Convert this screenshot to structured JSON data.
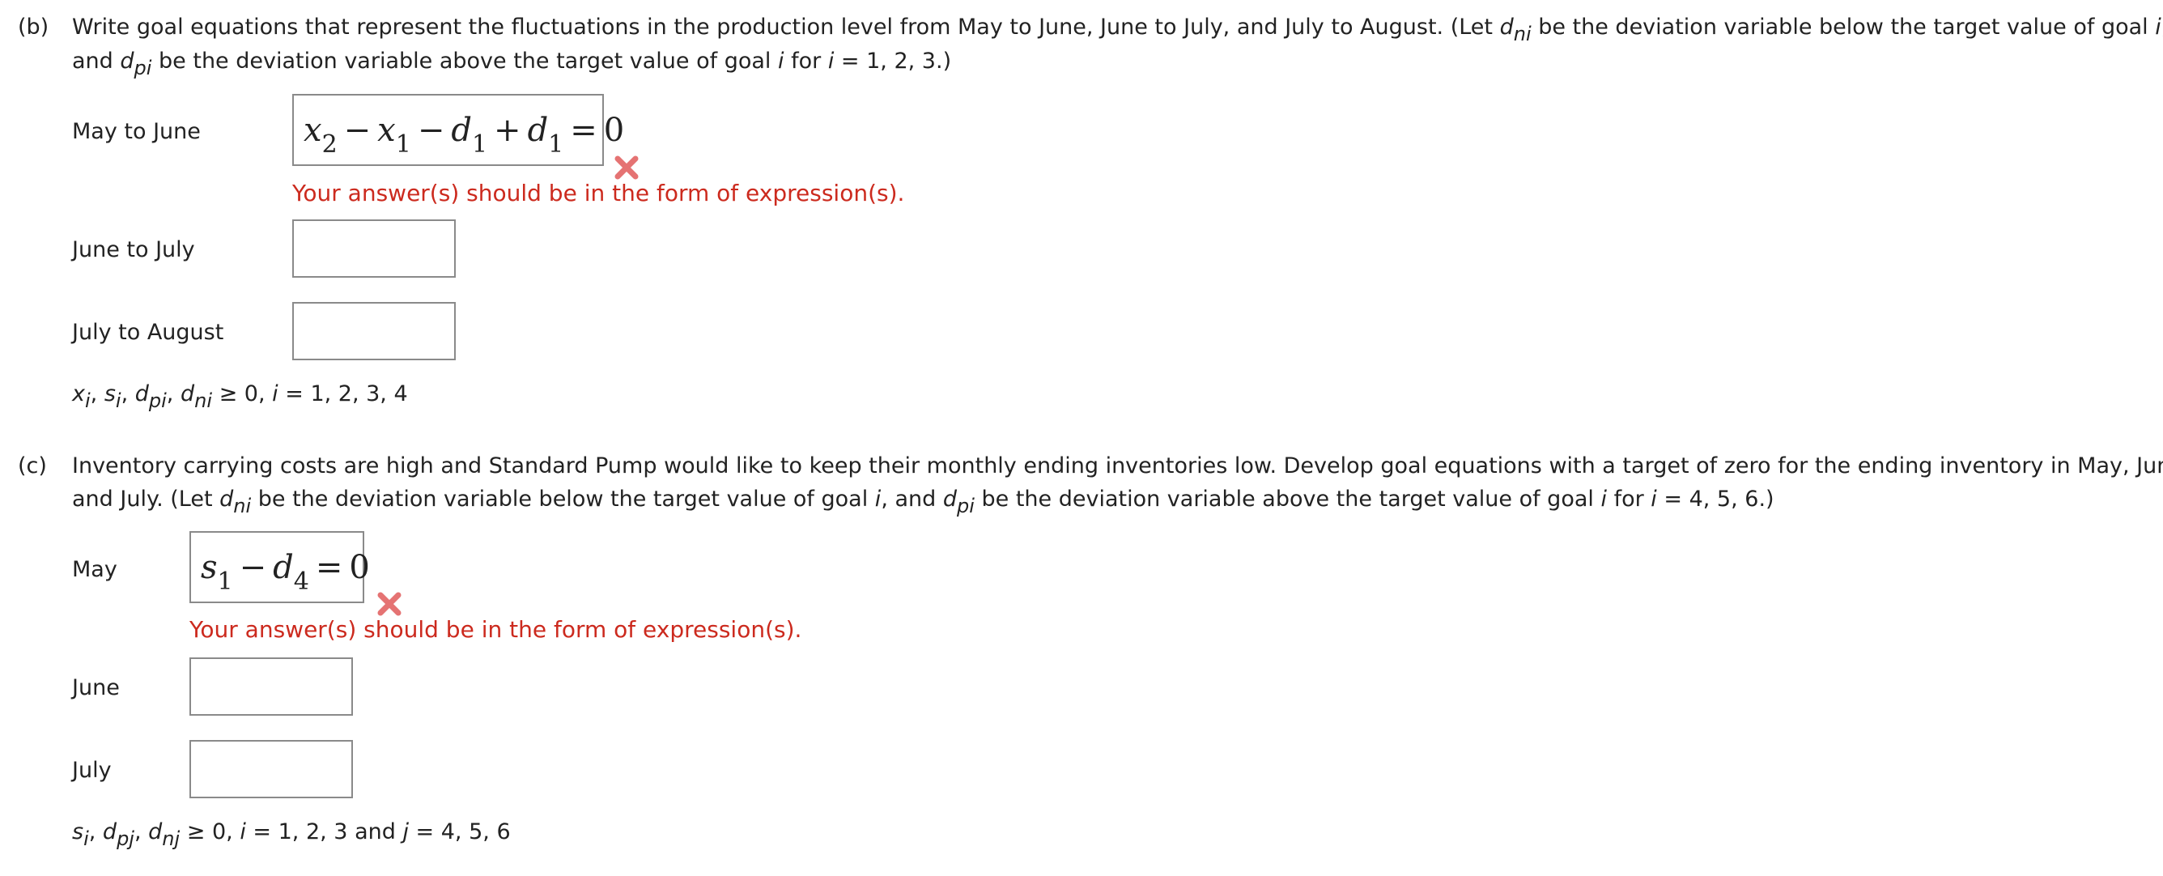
{
  "colors": {
    "text": "#222222",
    "error": "#cc2a1e",
    "xmark": "#e57373",
    "box_border": "#8a8a8a"
  },
  "part_b": {
    "marker": "(b)",
    "q_line1_a": "Write goal equations that represent the fluctuations in the production level from May to June, June to July, and July to August. (Let ",
    "q_line1_d": "d",
    "q_line1_sub": "ni",
    "q_line1_b": " be the deviation variable below the target value of goal ",
    "q_line1_i": "i",
    "q_line1_c": ",",
    "q_line2_a": "and ",
    "q_line2_d": "d",
    "q_line2_sub": "pi",
    "q_line2_b": " be the deviation variable above the target value of goal ",
    "q_line2_i": "i",
    "q_line2_c": " for ",
    "q_line2_i2": "i",
    "q_line2_d2": " = 1, 2, 3.)",
    "rows": [
      {
        "label": "May to June",
        "answer": {
          "t1": "x",
          "s1": "2",
          "op1": "−",
          "t2": "x",
          "s2": "1",
          "op2": "−",
          "t3": "d",
          "s3": "1",
          "op3": "+",
          "t4": "d",
          "s4": "1",
          "eq": "=",
          "rhs": "0"
        },
        "error": "Your answer(s) should be in the form of expression(s)."
      },
      {
        "label": "June to July",
        "value": ""
      },
      {
        "label": "July to August",
        "value": ""
      }
    ],
    "constraint": {
      "x": "x",
      "xs": "i",
      "sep1": ", ",
      "s": "s",
      "ss": "i",
      "sep2": ", ",
      "dp": "d",
      "dps": "pi",
      "sep3": ", ",
      "dn": "d",
      "dns": "ni",
      "rest_a": " ≥ 0, ",
      "i": "i",
      "rest_b": " = 1, 2, 3, 4"
    }
  },
  "part_c": {
    "marker": "(c)",
    "q_line1": "Inventory carrying costs are high and Standard Pump would like to keep their monthly ending inventories low. Develop goal equations with a target of zero for the ending inventory in May, June,",
    "q_line2_a": "and July. (Let ",
    "q_line2_d": "d",
    "q_line2_sub": "ni",
    "q_line2_b": " be the deviation variable below the target value of goal ",
    "q_line2_i": "i",
    "q_line2_c": ", and ",
    "q_line2_d2": "d",
    "q_line2_sub2": "pi",
    "q_line2_e": " be the deviation variable above the target value of goal ",
    "q_line2_i2": "i",
    "q_line2_f": " for ",
    "q_line2_i3": "i",
    "q_line2_g": " = 4, 5, 6.)",
    "rows": [
      {
        "label": "May",
        "answer": {
          "t1": "s",
          "s1": "1",
          "op1": "−",
          "t2": "d",
          "s2": "4",
          "eq": "=",
          "rhs": "0"
        },
        "error": "Your answer(s) should be in the form of expression(s)."
      },
      {
        "label": "June",
        "value": ""
      },
      {
        "label": "July",
        "value": ""
      }
    ],
    "constraint": {
      "s": "s",
      "ss": "i",
      "sep1": ", ",
      "dp": "d",
      "dps": "pj",
      "sep2": ", ",
      "dn": "d",
      "dns": "nj",
      "rest_a": " ≥ 0, ",
      "i": "i",
      "rest_b": " = 1, 2, 3 and ",
      "j": "j",
      "rest_c": " = 4, 5, 6"
    }
  }
}
